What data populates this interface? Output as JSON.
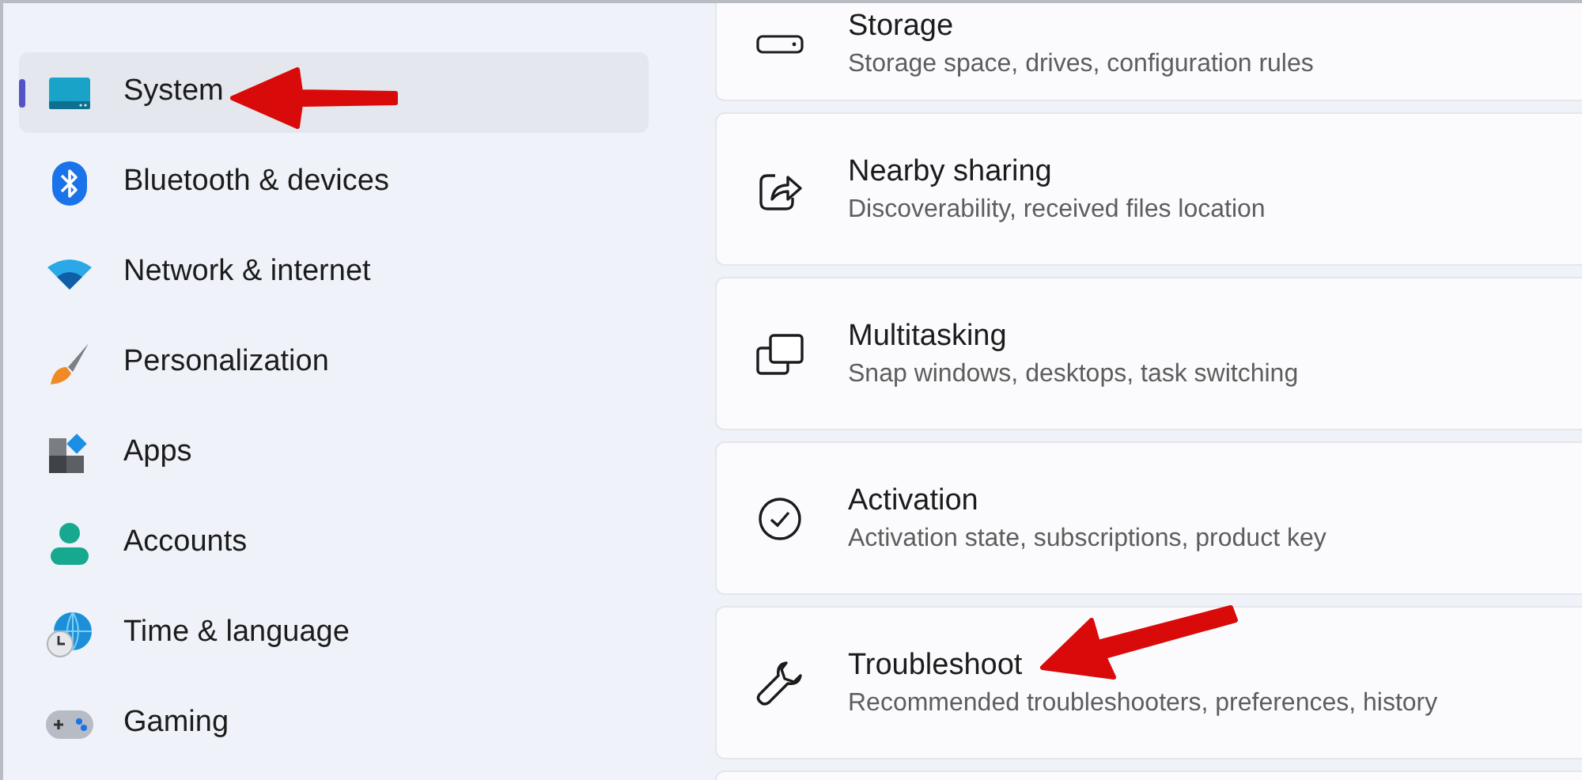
{
  "sidebar": {
    "items": [
      {
        "label": "System",
        "selected": true
      },
      {
        "label": "Bluetooth & devices",
        "selected": false
      },
      {
        "label": "Network & internet",
        "selected": false
      },
      {
        "label": "Personalization",
        "selected": false
      },
      {
        "label": "Apps",
        "selected": false
      },
      {
        "label": "Accounts",
        "selected": false
      },
      {
        "label": "Time & language",
        "selected": false
      },
      {
        "label": "Gaming",
        "selected": false
      }
    ]
  },
  "settings": [
    {
      "title": "Storage",
      "subtitle": "Storage space, drives, configuration rules"
    },
    {
      "title": "Nearby sharing",
      "subtitle": "Discoverability, received files location"
    },
    {
      "title": "Multitasking",
      "subtitle": "Snap windows, desktops, task switching"
    },
    {
      "title": "Activation",
      "subtitle": "Activation state, subscriptions, product key"
    },
    {
      "title": "Troubleshoot",
      "subtitle": "Recommended troubleshooters, preferences, history"
    }
  ]
}
